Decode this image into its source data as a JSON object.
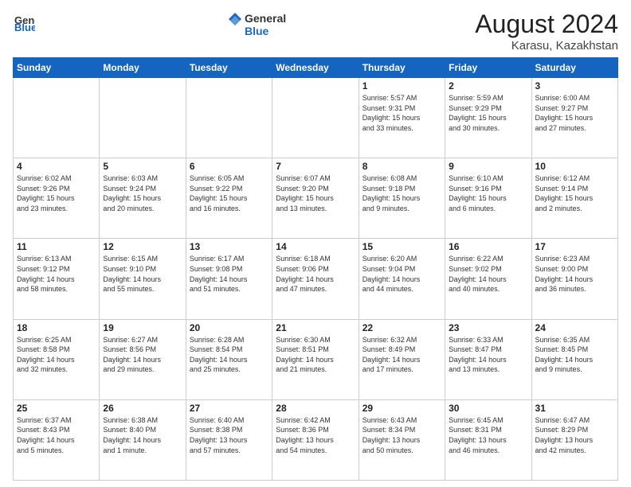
{
  "header": {
    "logo_general": "General",
    "logo_blue": "Blue",
    "title": "August 2024",
    "subtitle": "Karasu, Kazakhstan"
  },
  "weekdays": [
    "Sunday",
    "Monday",
    "Tuesday",
    "Wednesday",
    "Thursday",
    "Friday",
    "Saturday"
  ],
  "weeks": [
    [
      {
        "day": "",
        "info": ""
      },
      {
        "day": "",
        "info": ""
      },
      {
        "day": "",
        "info": ""
      },
      {
        "day": "",
        "info": ""
      },
      {
        "day": "1",
        "info": "Sunrise: 5:57 AM\nSunset: 9:31 PM\nDaylight: 15 hours\nand 33 minutes."
      },
      {
        "day": "2",
        "info": "Sunrise: 5:59 AM\nSunset: 9:29 PM\nDaylight: 15 hours\nand 30 minutes."
      },
      {
        "day": "3",
        "info": "Sunrise: 6:00 AM\nSunset: 9:27 PM\nDaylight: 15 hours\nand 27 minutes."
      }
    ],
    [
      {
        "day": "4",
        "info": "Sunrise: 6:02 AM\nSunset: 9:26 PM\nDaylight: 15 hours\nand 23 minutes."
      },
      {
        "day": "5",
        "info": "Sunrise: 6:03 AM\nSunset: 9:24 PM\nDaylight: 15 hours\nand 20 minutes."
      },
      {
        "day": "6",
        "info": "Sunrise: 6:05 AM\nSunset: 9:22 PM\nDaylight: 15 hours\nand 16 minutes."
      },
      {
        "day": "7",
        "info": "Sunrise: 6:07 AM\nSunset: 9:20 PM\nDaylight: 15 hours\nand 13 minutes."
      },
      {
        "day": "8",
        "info": "Sunrise: 6:08 AM\nSunset: 9:18 PM\nDaylight: 15 hours\nand 9 minutes."
      },
      {
        "day": "9",
        "info": "Sunrise: 6:10 AM\nSunset: 9:16 PM\nDaylight: 15 hours\nand 6 minutes."
      },
      {
        "day": "10",
        "info": "Sunrise: 6:12 AM\nSunset: 9:14 PM\nDaylight: 15 hours\nand 2 minutes."
      }
    ],
    [
      {
        "day": "11",
        "info": "Sunrise: 6:13 AM\nSunset: 9:12 PM\nDaylight: 14 hours\nand 58 minutes."
      },
      {
        "day": "12",
        "info": "Sunrise: 6:15 AM\nSunset: 9:10 PM\nDaylight: 14 hours\nand 55 minutes."
      },
      {
        "day": "13",
        "info": "Sunrise: 6:17 AM\nSunset: 9:08 PM\nDaylight: 14 hours\nand 51 minutes."
      },
      {
        "day": "14",
        "info": "Sunrise: 6:18 AM\nSunset: 9:06 PM\nDaylight: 14 hours\nand 47 minutes."
      },
      {
        "day": "15",
        "info": "Sunrise: 6:20 AM\nSunset: 9:04 PM\nDaylight: 14 hours\nand 44 minutes."
      },
      {
        "day": "16",
        "info": "Sunrise: 6:22 AM\nSunset: 9:02 PM\nDaylight: 14 hours\nand 40 minutes."
      },
      {
        "day": "17",
        "info": "Sunrise: 6:23 AM\nSunset: 9:00 PM\nDaylight: 14 hours\nand 36 minutes."
      }
    ],
    [
      {
        "day": "18",
        "info": "Sunrise: 6:25 AM\nSunset: 8:58 PM\nDaylight: 14 hours\nand 32 minutes."
      },
      {
        "day": "19",
        "info": "Sunrise: 6:27 AM\nSunset: 8:56 PM\nDaylight: 14 hours\nand 29 minutes."
      },
      {
        "day": "20",
        "info": "Sunrise: 6:28 AM\nSunset: 8:54 PM\nDaylight: 14 hours\nand 25 minutes."
      },
      {
        "day": "21",
        "info": "Sunrise: 6:30 AM\nSunset: 8:51 PM\nDaylight: 14 hours\nand 21 minutes."
      },
      {
        "day": "22",
        "info": "Sunrise: 6:32 AM\nSunset: 8:49 PM\nDaylight: 14 hours\nand 17 minutes."
      },
      {
        "day": "23",
        "info": "Sunrise: 6:33 AM\nSunset: 8:47 PM\nDaylight: 14 hours\nand 13 minutes."
      },
      {
        "day": "24",
        "info": "Sunrise: 6:35 AM\nSunset: 8:45 PM\nDaylight: 14 hours\nand 9 minutes."
      }
    ],
    [
      {
        "day": "25",
        "info": "Sunrise: 6:37 AM\nSunset: 8:43 PM\nDaylight: 14 hours\nand 5 minutes."
      },
      {
        "day": "26",
        "info": "Sunrise: 6:38 AM\nSunset: 8:40 PM\nDaylight: 14 hours\nand 1 minute."
      },
      {
        "day": "27",
        "info": "Sunrise: 6:40 AM\nSunset: 8:38 PM\nDaylight: 13 hours\nand 57 minutes."
      },
      {
        "day": "28",
        "info": "Sunrise: 6:42 AM\nSunset: 8:36 PM\nDaylight: 13 hours\nand 54 minutes."
      },
      {
        "day": "29",
        "info": "Sunrise: 6:43 AM\nSunset: 8:34 PM\nDaylight: 13 hours\nand 50 minutes."
      },
      {
        "day": "30",
        "info": "Sunrise: 6:45 AM\nSunset: 8:31 PM\nDaylight: 13 hours\nand 46 minutes."
      },
      {
        "day": "31",
        "info": "Sunrise: 6:47 AM\nSunset: 8:29 PM\nDaylight: 13 hours\nand 42 minutes."
      }
    ]
  ]
}
